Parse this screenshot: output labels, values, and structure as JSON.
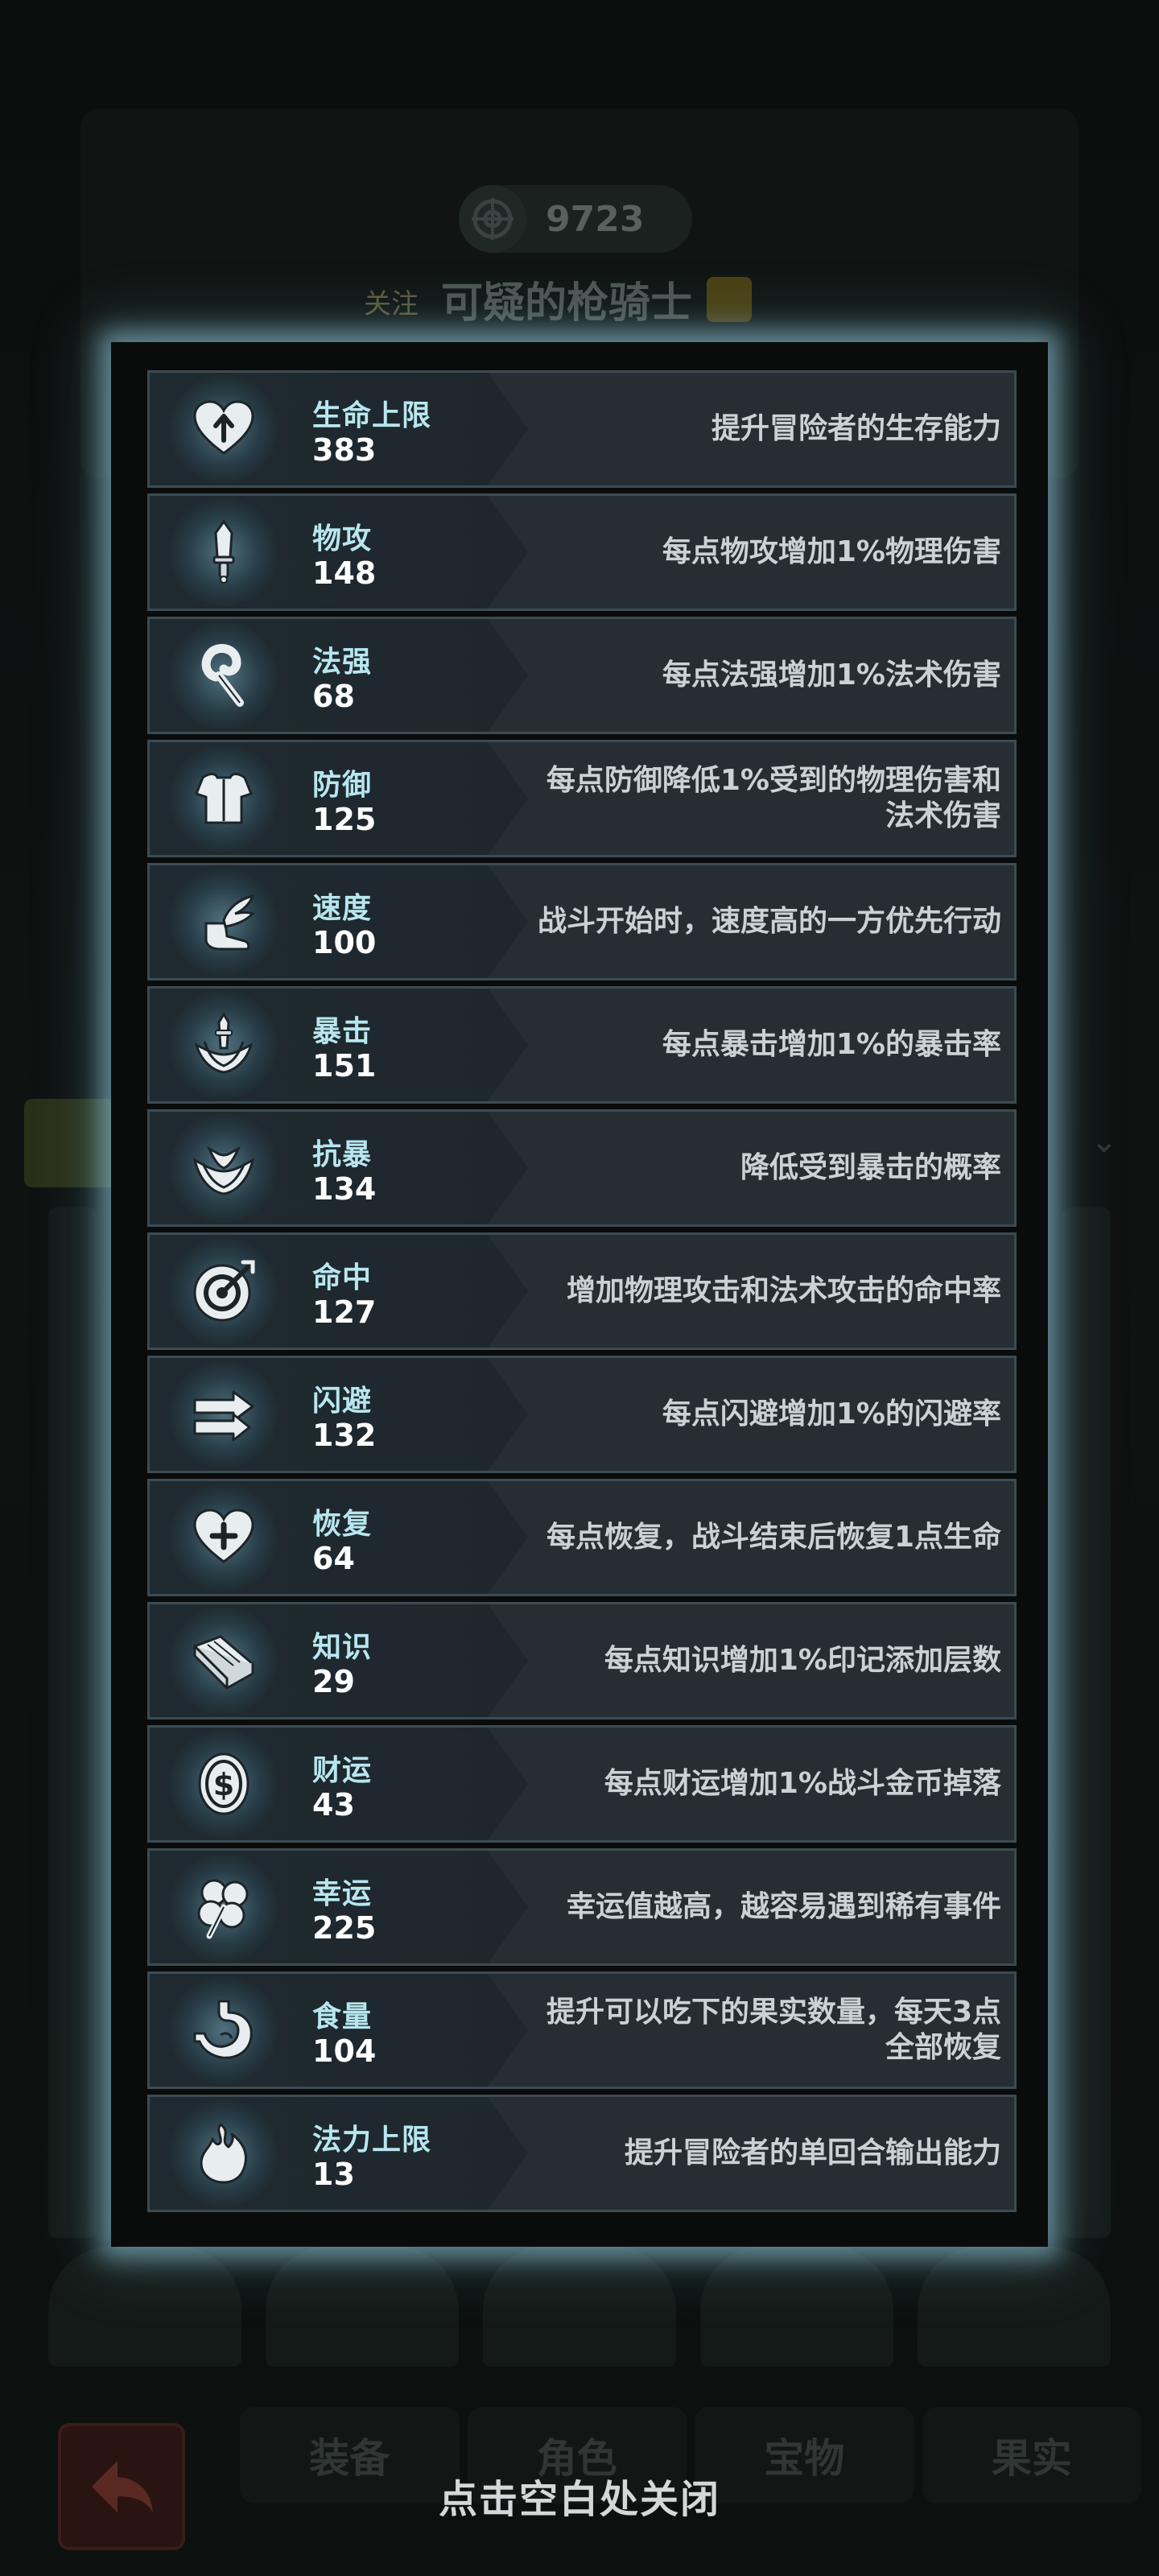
{
  "background": {
    "score": "9723",
    "follow_label": "关注",
    "character_name": "可疑的枪骑士",
    "tabs": [
      "装备",
      "角色",
      "宝物",
      "果实"
    ]
  },
  "stats": [
    {
      "name": "生命上限",
      "value": "383",
      "icon": "heart-up-icon",
      "desc": "提升冒险者的生存能力"
    },
    {
      "name": "物攻",
      "value": "148",
      "icon": "sword-icon",
      "desc": "每点物攻增加1%物理伤害"
    },
    {
      "name": "法强",
      "value": "68",
      "icon": "staff-icon",
      "desc": "每点法强增加1%法术伤害"
    },
    {
      "name": "防御",
      "value": "125",
      "icon": "armor-icon",
      "desc": "每点防御降低1%受到的物理伤害和法术伤害"
    },
    {
      "name": "速度",
      "value": "100",
      "icon": "winged-boot-icon",
      "desc": "战斗开始时，速度高的一方优先行动"
    },
    {
      "name": "暴击",
      "value": "151",
      "icon": "crit-icon",
      "desc": "每点暴击增加1%的暴击率"
    },
    {
      "name": "抗暴",
      "value": "134",
      "icon": "crit-resist-icon",
      "desc": "降低受到暴击的概率"
    },
    {
      "name": "命中",
      "value": "127",
      "icon": "target-icon",
      "desc": "增加物理攻击和法术攻击的命中率"
    },
    {
      "name": "闪避",
      "value": "132",
      "icon": "dodge-arrows-icon",
      "desc": "每点闪避增加1%的闪避率"
    },
    {
      "name": "恢复",
      "value": "64",
      "icon": "heart-plus-icon",
      "desc": "每点恢复，战斗结束后恢复1点生命"
    },
    {
      "name": "知识",
      "value": "29",
      "icon": "book-icon",
      "desc": "每点知识增加1%印记添加层数"
    },
    {
      "name": "财运",
      "value": "43",
      "icon": "coin-icon",
      "desc": "每点财运增加1%战斗金币掉落"
    },
    {
      "name": "幸运",
      "value": "225",
      "icon": "clover-icon",
      "desc": "幸运值越高，越容易遇到稀有事件"
    },
    {
      "name": "食量",
      "value": "104",
      "icon": "stomach-icon",
      "desc": "提升可以吃下的果实数量，每天3点全部恢复"
    },
    {
      "name": "法力上限",
      "value": "13",
      "icon": "mana-flame-icon",
      "desc": "提升冒险者的单回合输出能力"
    }
  ],
  "close_hint": "点击空白处关闭"
}
